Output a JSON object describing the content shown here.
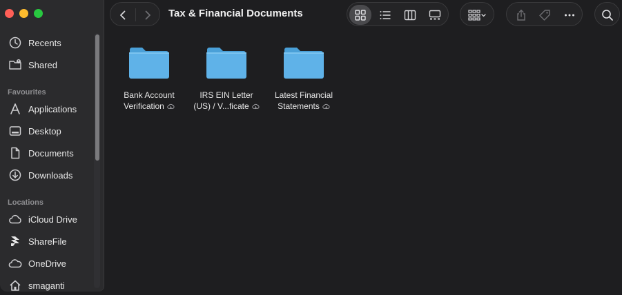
{
  "window": {
    "title": "Tax & Financial Documents"
  },
  "sidebar": {
    "sections": [
      {
        "heading": "",
        "items": [
          {
            "label": "Recents",
            "icon": "clock-icon"
          },
          {
            "label": "Shared",
            "icon": "shared-folder-icon"
          }
        ]
      },
      {
        "heading": "Favourites",
        "items": [
          {
            "label": "Applications",
            "icon": "applications-icon"
          },
          {
            "label": "Desktop",
            "icon": "desktop-icon"
          },
          {
            "label": "Documents",
            "icon": "document-icon"
          },
          {
            "label": "Downloads",
            "icon": "download-icon"
          }
        ]
      },
      {
        "heading": "Locations",
        "items": [
          {
            "label": "iCloud Drive",
            "icon": "icloud-icon"
          },
          {
            "label": "ShareFile",
            "icon": "sharefile-icon"
          },
          {
            "label": "OneDrive",
            "icon": "onedrive-icon"
          },
          {
            "label": "smaganti",
            "icon": "home-icon"
          }
        ]
      }
    ]
  },
  "toolbar": {
    "view_modes": [
      "icon",
      "list",
      "columns",
      "gallery"
    ],
    "active_view": "icon"
  },
  "files": [
    {
      "line1": "Bank Account",
      "line2": "Verification",
      "cloud": true
    },
    {
      "line1": "IRS EIN Letter",
      "line2": "(US) / V...ficate",
      "cloud": true
    },
    {
      "line1": "Latest Financial",
      "line2": "Statements",
      "cloud": true
    }
  ],
  "colors": {
    "folder": "#5fb2e8",
    "folder_tab": "#4aa0d8",
    "close": "#ff5f57",
    "minimize": "#febc2e",
    "maximize": "#28c840"
  }
}
